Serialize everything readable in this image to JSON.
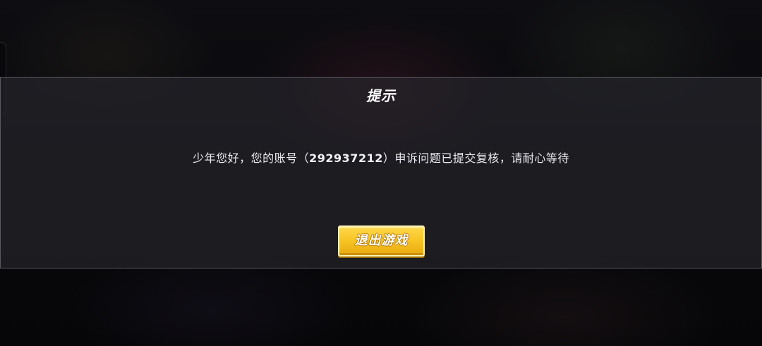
{
  "dialog": {
    "title": "提示",
    "message_prefix": "少年您好，您的账号（",
    "account_id": "292937212",
    "message_suffix": "）申诉问题已提交复核，请耐心等待",
    "exit_button_label": "退出游戏"
  },
  "colors": {
    "button_accent": "#f7c423",
    "button_border": "#fff3b0",
    "dialog_border": "#c8c8d2",
    "text": "#ffffff"
  }
}
